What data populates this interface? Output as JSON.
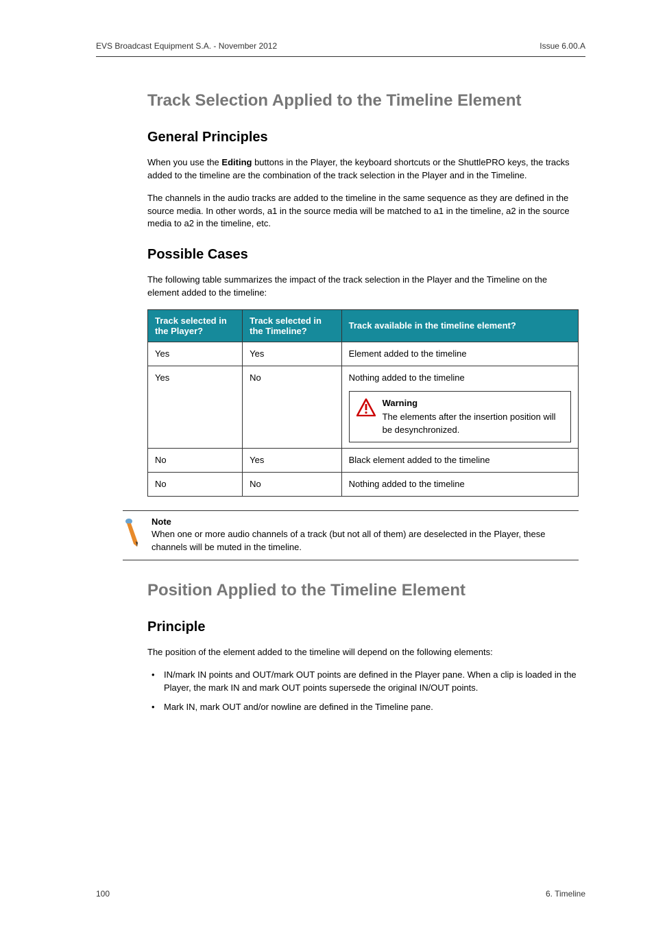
{
  "header": {
    "left": "EVS Broadcast Equipment S.A.  - November 2012",
    "right": "Issue 6.00.A"
  },
  "section1": {
    "title": "Track Selection Applied to the Timeline Element",
    "sub1": {
      "title": "General Principles",
      "p1_pre": "When you use the ",
      "p1_bold": "Editing",
      "p1_post": " buttons in the Player, the keyboard shortcuts or the ShuttlePRO keys, the tracks added to the timeline are the combination of the track selection in the Player and in the Timeline.",
      "p2": "The channels in the audio tracks are added to the timeline in the same sequence as they are defined in the source media. In other words, a1 in the source media will be matched to a1 in the timeline, a2 in the source media to a2 in the timeline, etc."
    },
    "sub2": {
      "title": "Possible Cases",
      "intro": "The following table summarizes the impact of the track selection in the Player and the Timeline on the element added to the timeline:",
      "table": {
        "headers": {
          "c1": "Track selected in the Player?",
          "c2": "Track selected in the Timeline?",
          "c3": "Track available in the timeline element?"
        },
        "rows": [
          {
            "c1": "Yes",
            "c2": "Yes",
            "c3": "Element added to the timeline",
            "warn": null
          },
          {
            "c1": "Yes",
            "c2": "No",
            "c3": "Nothing added to the timeline",
            "warn": {
              "title": "Warning",
              "body": "The elements after the insertion position will be desynchronized."
            }
          },
          {
            "c1": "No",
            "c2": "Yes",
            "c3": "Black element added to the timeline",
            "warn": null
          },
          {
            "c1": "No",
            "c2": "No",
            "c3": "Nothing added to the timeline",
            "warn": null
          }
        ]
      },
      "note": {
        "title": "Note",
        "body": "When one or more audio channels of a track (but not all of them) are deselected in the Player, these channels will be muted in the timeline."
      }
    }
  },
  "section2": {
    "title": "Position Applied to the Timeline Element",
    "sub1": {
      "title": "Principle",
      "intro": "The position of the element added to the timeline will depend on the following elements:",
      "bullets": [
        "IN/mark IN points and OUT/mark OUT points are defined in the Player pane. When a clip is loaded in the Player, the mark IN and mark OUT points supersede the original IN/OUT points.",
        "Mark IN, mark OUT and/or nowline are defined in the Timeline pane."
      ]
    }
  },
  "footer": {
    "left": "100",
    "right": "6. Timeline"
  }
}
